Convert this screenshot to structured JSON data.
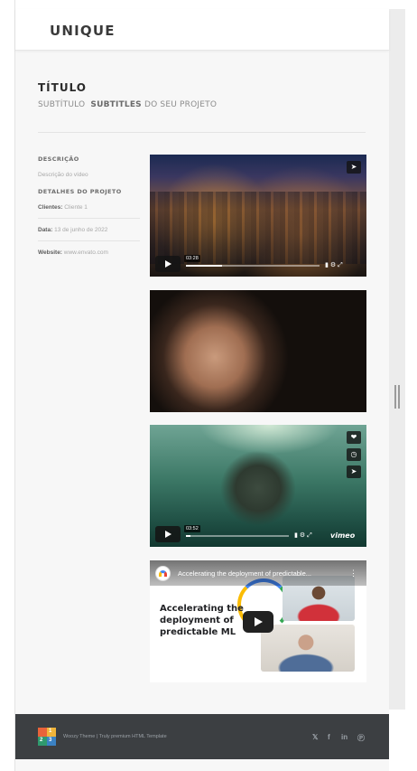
{
  "site": {
    "logo": "UNIQUE"
  },
  "project": {
    "title": "TÍTULO",
    "subtitle_prefix": "SUBTÍTULO",
    "subtitle_bold": "SUBTITLES",
    "subtitle_suffix": "DO SEU PROJETO"
  },
  "details": {
    "description_heading": "DESCRIÇÃO",
    "description_text": "Descrição do vídeo",
    "details_heading": "DETALHES DO PROJETO",
    "client_label": "Clientes:",
    "client_value": "Cliente 1",
    "date_label": "Data:",
    "date_value": "13 de junho de 2022",
    "website_label": "Website:",
    "website_value": "www.envato.com"
  },
  "videos": {
    "video1": {
      "time": "03:28",
      "progress": 0.27,
      "icons": [
        "share-icon",
        "volume-icon",
        "settings-icon",
        "fullscreen-icon"
      ]
    },
    "video2": {
      "icons": []
    },
    "video3": {
      "time": "03:52",
      "progress": 0.04,
      "brand": "vimeo",
      "icons": [
        "like-icon",
        "watch-later-icon",
        "share-icon"
      ]
    },
    "video4": {
      "title": "Accelerating the deployment of predictable...",
      "headline": "Accelerating the deployment of predictable ML",
      "colors": {
        "blue": "#4285f4",
        "green": "#34a853",
        "yellow": "#fbbc05",
        "red": "#ea4335"
      }
    }
  },
  "footer": {
    "text": "Woozy Theme | Truly premium HTML Template",
    "logo_digits": [
      "1",
      "2",
      "3"
    ],
    "social": [
      "twitter-icon",
      "facebook-icon",
      "linkedin-icon",
      "pinterest-icon"
    ],
    "bg": "#3c3f42"
  }
}
